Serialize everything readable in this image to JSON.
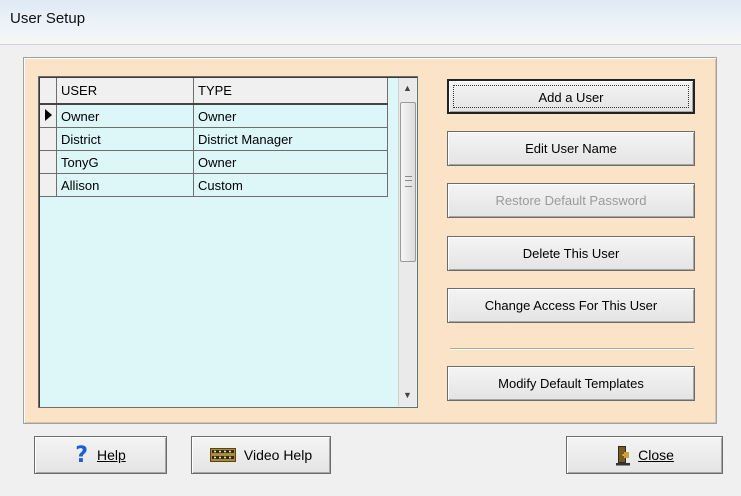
{
  "window": {
    "title": "User Setup"
  },
  "grid": {
    "columns": [
      "USER",
      "TYPE"
    ],
    "rows": [
      {
        "user": "Owner",
        "type": "Owner",
        "current": true
      },
      {
        "user": "District",
        "type": "District Manager",
        "current": false
      },
      {
        "user": "TonyG",
        "type": "Owner",
        "current": false
      },
      {
        "user": "Allison",
        "type": "Custom",
        "current": false
      }
    ]
  },
  "actions": {
    "add_user": "Add a User",
    "edit_name": "Edit User Name",
    "restore_password": "Restore Default Password",
    "delete_user": "Delete This User",
    "change_access": "Change Access For This User",
    "modify_templates": "Modify Default Templates"
  },
  "footer": {
    "help_label": "Help",
    "video_help_label": "Video Help",
    "close_label": "Close"
  },
  "icons": {
    "help": "question-mark-icon",
    "video": "film-reel-icon",
    "close": "door-exit-icon",
    "row_pointer": "row-pointer-icon"
  },
  "colors": {
    "panel_bg": "#fbe3c8",
    "grid_bg": "#ddf7f9",
    "help_icon": "#1d5fd0"
  }
}
